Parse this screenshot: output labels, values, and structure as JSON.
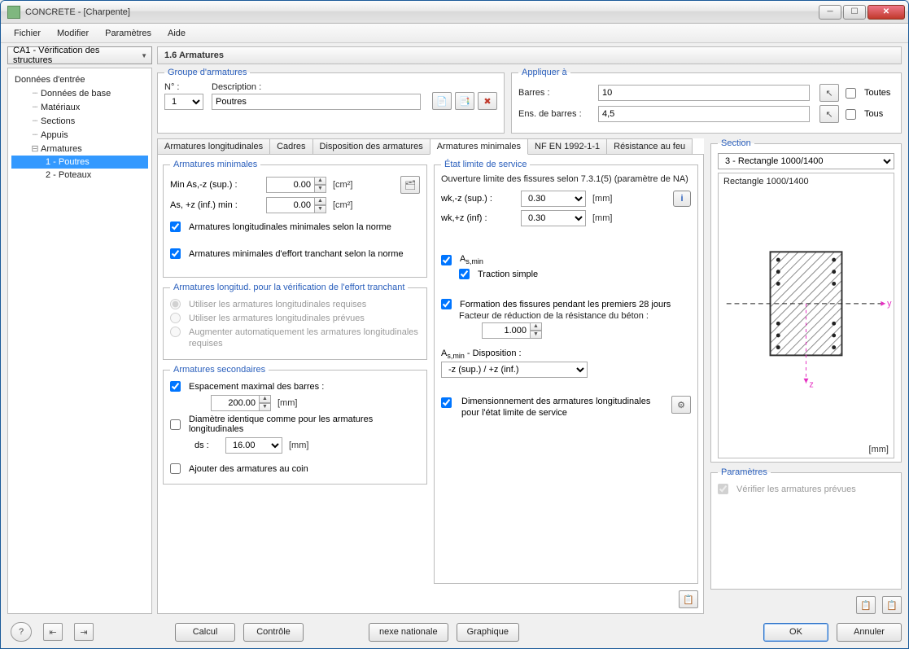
{
  "window": {
    "title": "CONCRETE - [Charpente]"
  },
  "menubar": {
    "fichier": "Fichier",
    "modifier": "Modifier",
    "parametres": "Paramètres",
    "aide": "Aide"
  },
  "nav": {
    "case": "CA1 - Vérification des structures",
    "section_title": "1.6 Armatures"
  },
  "tree": {
    "root": "Données d'entrée",
    "n1": "Données de base",
    "n2": "Matériaux",
    "n3": "Sections",
    "n4": "Appuis",
    "n5": "Armatures",
    "n5a": "1 - Poutres",
    "n5b": "2 - Poteaux"
  },
  "group_box": {
    "legend": "Groupe d'armatures",
    "no_label": "N° :",
    "desc_label": "Description :",
    "no_value": "1",
    "desc_value": "Poutres"
  },
  "apply_box": {
    "legend": "Appliquer à",
    "barres_label": "Barres :",
    "barres_value": "10",
    "ens_label": "Ens. de barres :",
    "ens_value": "4,5",
    "toutes": "Toutes",
    "tous": "Tous"
  },
  "tabs": {
    "t1": "Armatures longitudinales",
    "t2": "Cadres",
    "t3": "Disposition des armatures",
    "t4": "Armatures minimales",
    "t5": "NF EN 1992-1-1",
    "t6": "Résistance au feu"
  },
  "armmin": {
    "legend": "Armatures minimales",
    "min_sup_label": "Min As,-z (sup.) :",
    "min_sup_val": "0.00",
    "inf_label": "As, +z (inf.) min :",
    "inf_val": "0.00",
    "cm2": "[cm²]",
    "chk1": "Armatures longitudinales minimales selon la norme",
    "chk2": "Armatures minimales d'effort tranchant selon la norme"
  },
  "longverif": {
    "legend": "Armatures longitud. pour la vérification de l'effort tranchant",
    "r1": "Utiliser les armatures longitudinales requises",
    "r2": "Utiliser les armatures longitudinales prévues",
    "r3": "Augmenter automatiquement les armatures longitudinales requises"
  },
  "armsec": {
    "legend": "Armatures secondaires",
    "chk_esp": "Espacement maximal des barres :",
    "esp_val": "200.00",
    "mm": "[mm]",
    "chk_diam": "Diamètre identique comme pour les armatures longitudinales",
    "ds_label": "ds :",
    "ds_val": "16.00",
    "chk_coin": "Ajouter des armatures au coin"
  },
  "els": {
    "legend": "État limite de service",
    "ouv_label": "Ouverture limite des fissures selon 7.3.1(5) (paramètre de NA)",
    "wk_sup": "wk,-z (sup.) :",
    "wk_inf": "wk,+z (inf) :",
    "wk_sup_val": "0.30",
    "wk_inf_val": "0.30",
    "mm": "[mm]",
    "asmin": "As,min",
    "traction": "Traction simple",
    "formation": "Formation des fissures pendant les premiers 28 jours",
    "facteur": "Facteur de réduction de la résistance du béton :",
    "facteur_val": "1.000",
    "dispo_label": "As,min - Disposition :",
    "dispo_val": "-z (sup.) / +z (inf.)",
    "dim_long": "Dimensionnement des armatures longitudinales pour l'état limite de service"
  },
  "section": {
    "legend": "Section",
    "combo": "3 - Rectangle 1000/1400",
    "label": "Rectangle 1000/1400",
    "mm": "[mm]",
    "y": "y",
    "z": "z"
  },
  "params": {
    "legend": "Paramètres",
    "chk": "Vérifier les armatures prévues"
  },
  "footer": {
    "calcul": "Calcul",
    "controle": "Contrôle",
    "nexe": "nexe nationale",
    "graphique": "Graphique",
    "ok": "OK",
    "annuler": "Annuler"
  }
}
